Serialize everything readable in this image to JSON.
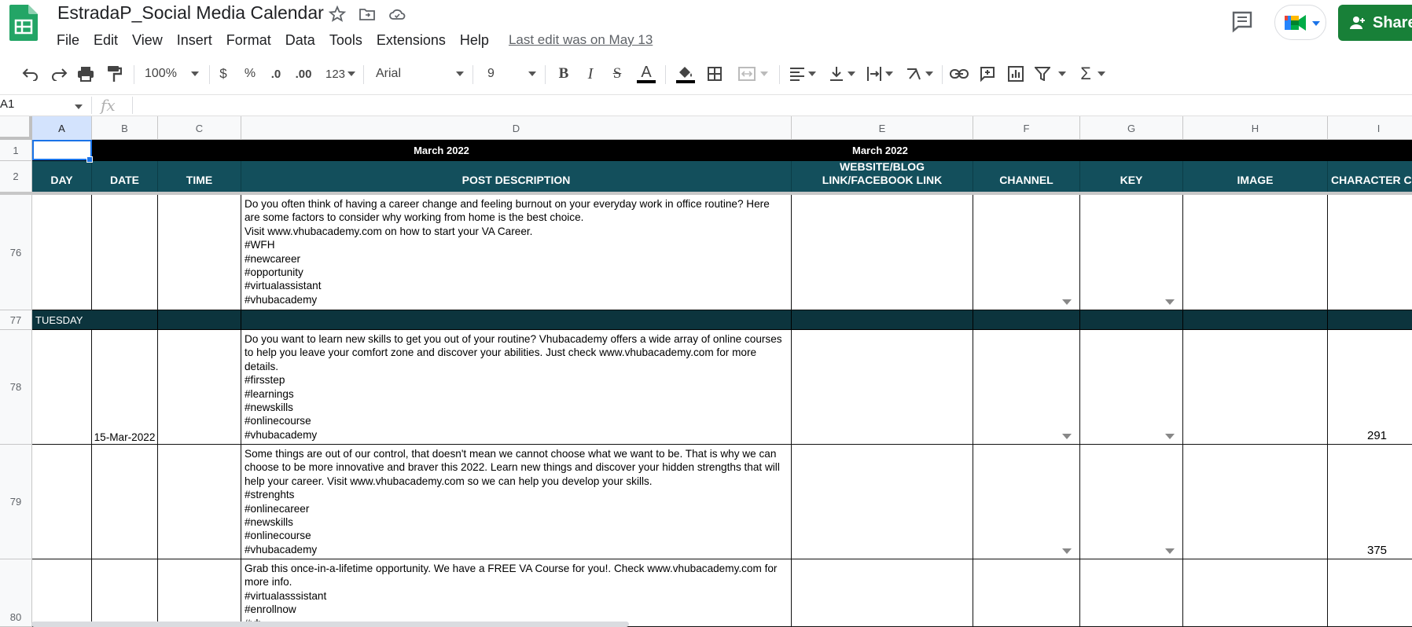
{
  "app": {
    "title": "EstradaP_Social Media Calendar",
    "last_edit": "Last edit was on May 13",
    "share_label": "Share",
    "brand_color": "#188038"
  },
  "menu": [
    "File",
    "Edit",
    "View",
    "Insert",
    "Format",
    "Data",
    "Tools",
    "Extensions",
    "Help"
  ],
  "toolbar": {
    "zoom": "100%",
    "currency": "$",
    "percent": "%",
    "decrease_decimal": ".0",
    "increase_decimal": ".00",
    "more_formats": "123",
    "font": "Arial",
    "font_size": "9",
    "icons": [
      "undo-icon",
      "redo-icon",
      "print-icon",
      "paint-format-icon",
      "bold-icon",
      "italic-icon",
      "strikethrough-icon",
      "text-color-icon",
      "fill-color-icon",
      "borders-icon",
      "merge-cells-icon",
      "horizontal-align-icon",
      "vertical-align-icon",
      "text-wrap-icon",
      "text-rotation-icon",
      "link-icon",
      "comment-icon",
      "chart-icon",
      "filter-icon",
      "functions-icon"
    ]
  },
  "formula_bar": {
    "cell_ref": "A1",
    "fx": "fx",
    "content": ""
  },
  "grid": {
    "columns": [
      "A",
      "B",
      "C",
      "D",
      "E",
      "F",
      "G",
      "H",
      "I"
    ],
    "rows": [
      "1",
      "2",
      "76",
      "77",
      "78",
      "79",
      "80"
    ],
    "banner_left": "March 2022",
    "banner_right": "March 2022",
    "headers": {
      "day": "DAY",
      "date": "DATE",
      "time": "TIME",
      "post_description": "POST DESCRIPTION",
      "link": "WEBSITE/BLOG LINK/FACEBOOK LINK",
      "channel": "CHANNEL",
      "key": "KEY",
      "image": "IMAGE",
      "char_count": "CHARACTER COU"
    },
    "day_label": "TUESDAY",
    "posts": [
      {
        "row": "76",
        "date": "",
        "description": "Do you often think of having a career change and feeling burnout on your everyday work in office routine? Here are some factors to consider why working from home is the best choice.\nVisit www.vhubacademy.com on how to start your VA Career.\n#WFH\n#newcareer\n#opportunity\n#virtualassistant\n#vhubacademy",
        "count": ""
      },
      {
        "row": "78",
        "date": "15-Mar-2022",
        "description": "Do you want to learn new skills to get you out of your routine? Vhubacademy offers a wide array of online courses to help you leave your comfort zone and discover your abilities. Just check www.vhubacademy.com for more details.\n#firsstep\n#learnings\n#newskills\n#onlinecourse\n#vhubacademy",
        "count": "291"
      },
      {
        "row": "79",
        "date": "",
        "description": "Some things are out of our control, that doesn't mean we cannot choose what we want to be. That is why we can choose to be more innovative and braver this 2022. Learn new things and discover your hidden strengths that will help your career. Visit www.vhubacademy.com so we can help you develop your skills.\n#strenghts\n#onlinecareer\n#newskills\n#onlinecourse\n#vhubacademy",
        "count": "375"
      },
      {
        "row": "80",
        "date": "",
        "description": "Grab this once-in-a-lifetime opportunity. We have a FREE VA Course for you!. Check www.vhubacademy.com for more info.\n#virtualasssistant\n#enrollnow\n#vh...",
        "count": ""
      }
    ]
  },
  "colors": {
    "header_teal": "#134f5c",
    "day_row": "#0c343d",
    "banner_black": "#000000",
    "selection_blue": "#1a73e8"
  }
}
